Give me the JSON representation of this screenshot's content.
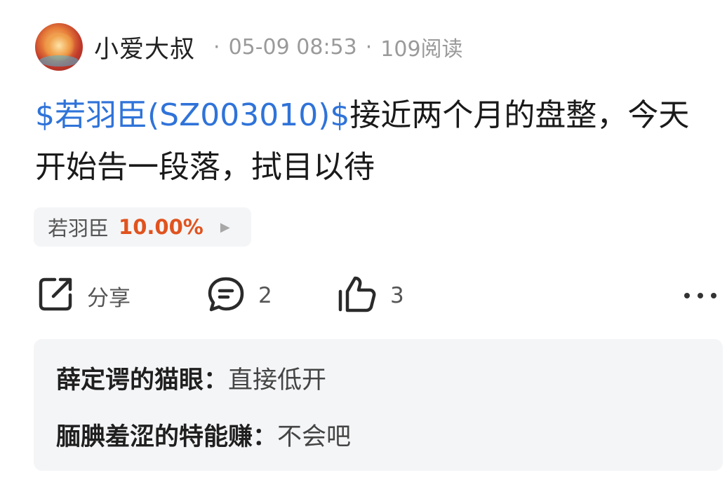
{
  "post": {
    "author": "小爱大叔",
    "separator": "·",
    "time": "05-09 08:53",
    "views": "109阅读",
    "content": {
      "cashtag": "$若羽臣(SZ003010)$",
      "text": "接近两个月的盘整，今天开始告一段落，拭目以待"
    },
    "stock_chip": {
      "name": "若羽臣",
      "change": "10.00%",
      "arrow": "▶"
    }
  },
  "actions": {
    "share_label": "分享",
    "comment_count": "2",
    "like_count": "3"
  },
  "comments": [
    {
      "name": "薛定谔的猫眼：",
      "text": "直接低开"
    },
    {
      "name": "腼腆羞涩的特能赚：",
      "text": "不会吧"
    }
  ],
  "colors": {
    "cashtag": "#2f73d9",
    "change_up": "#e0531f"
  }
}
